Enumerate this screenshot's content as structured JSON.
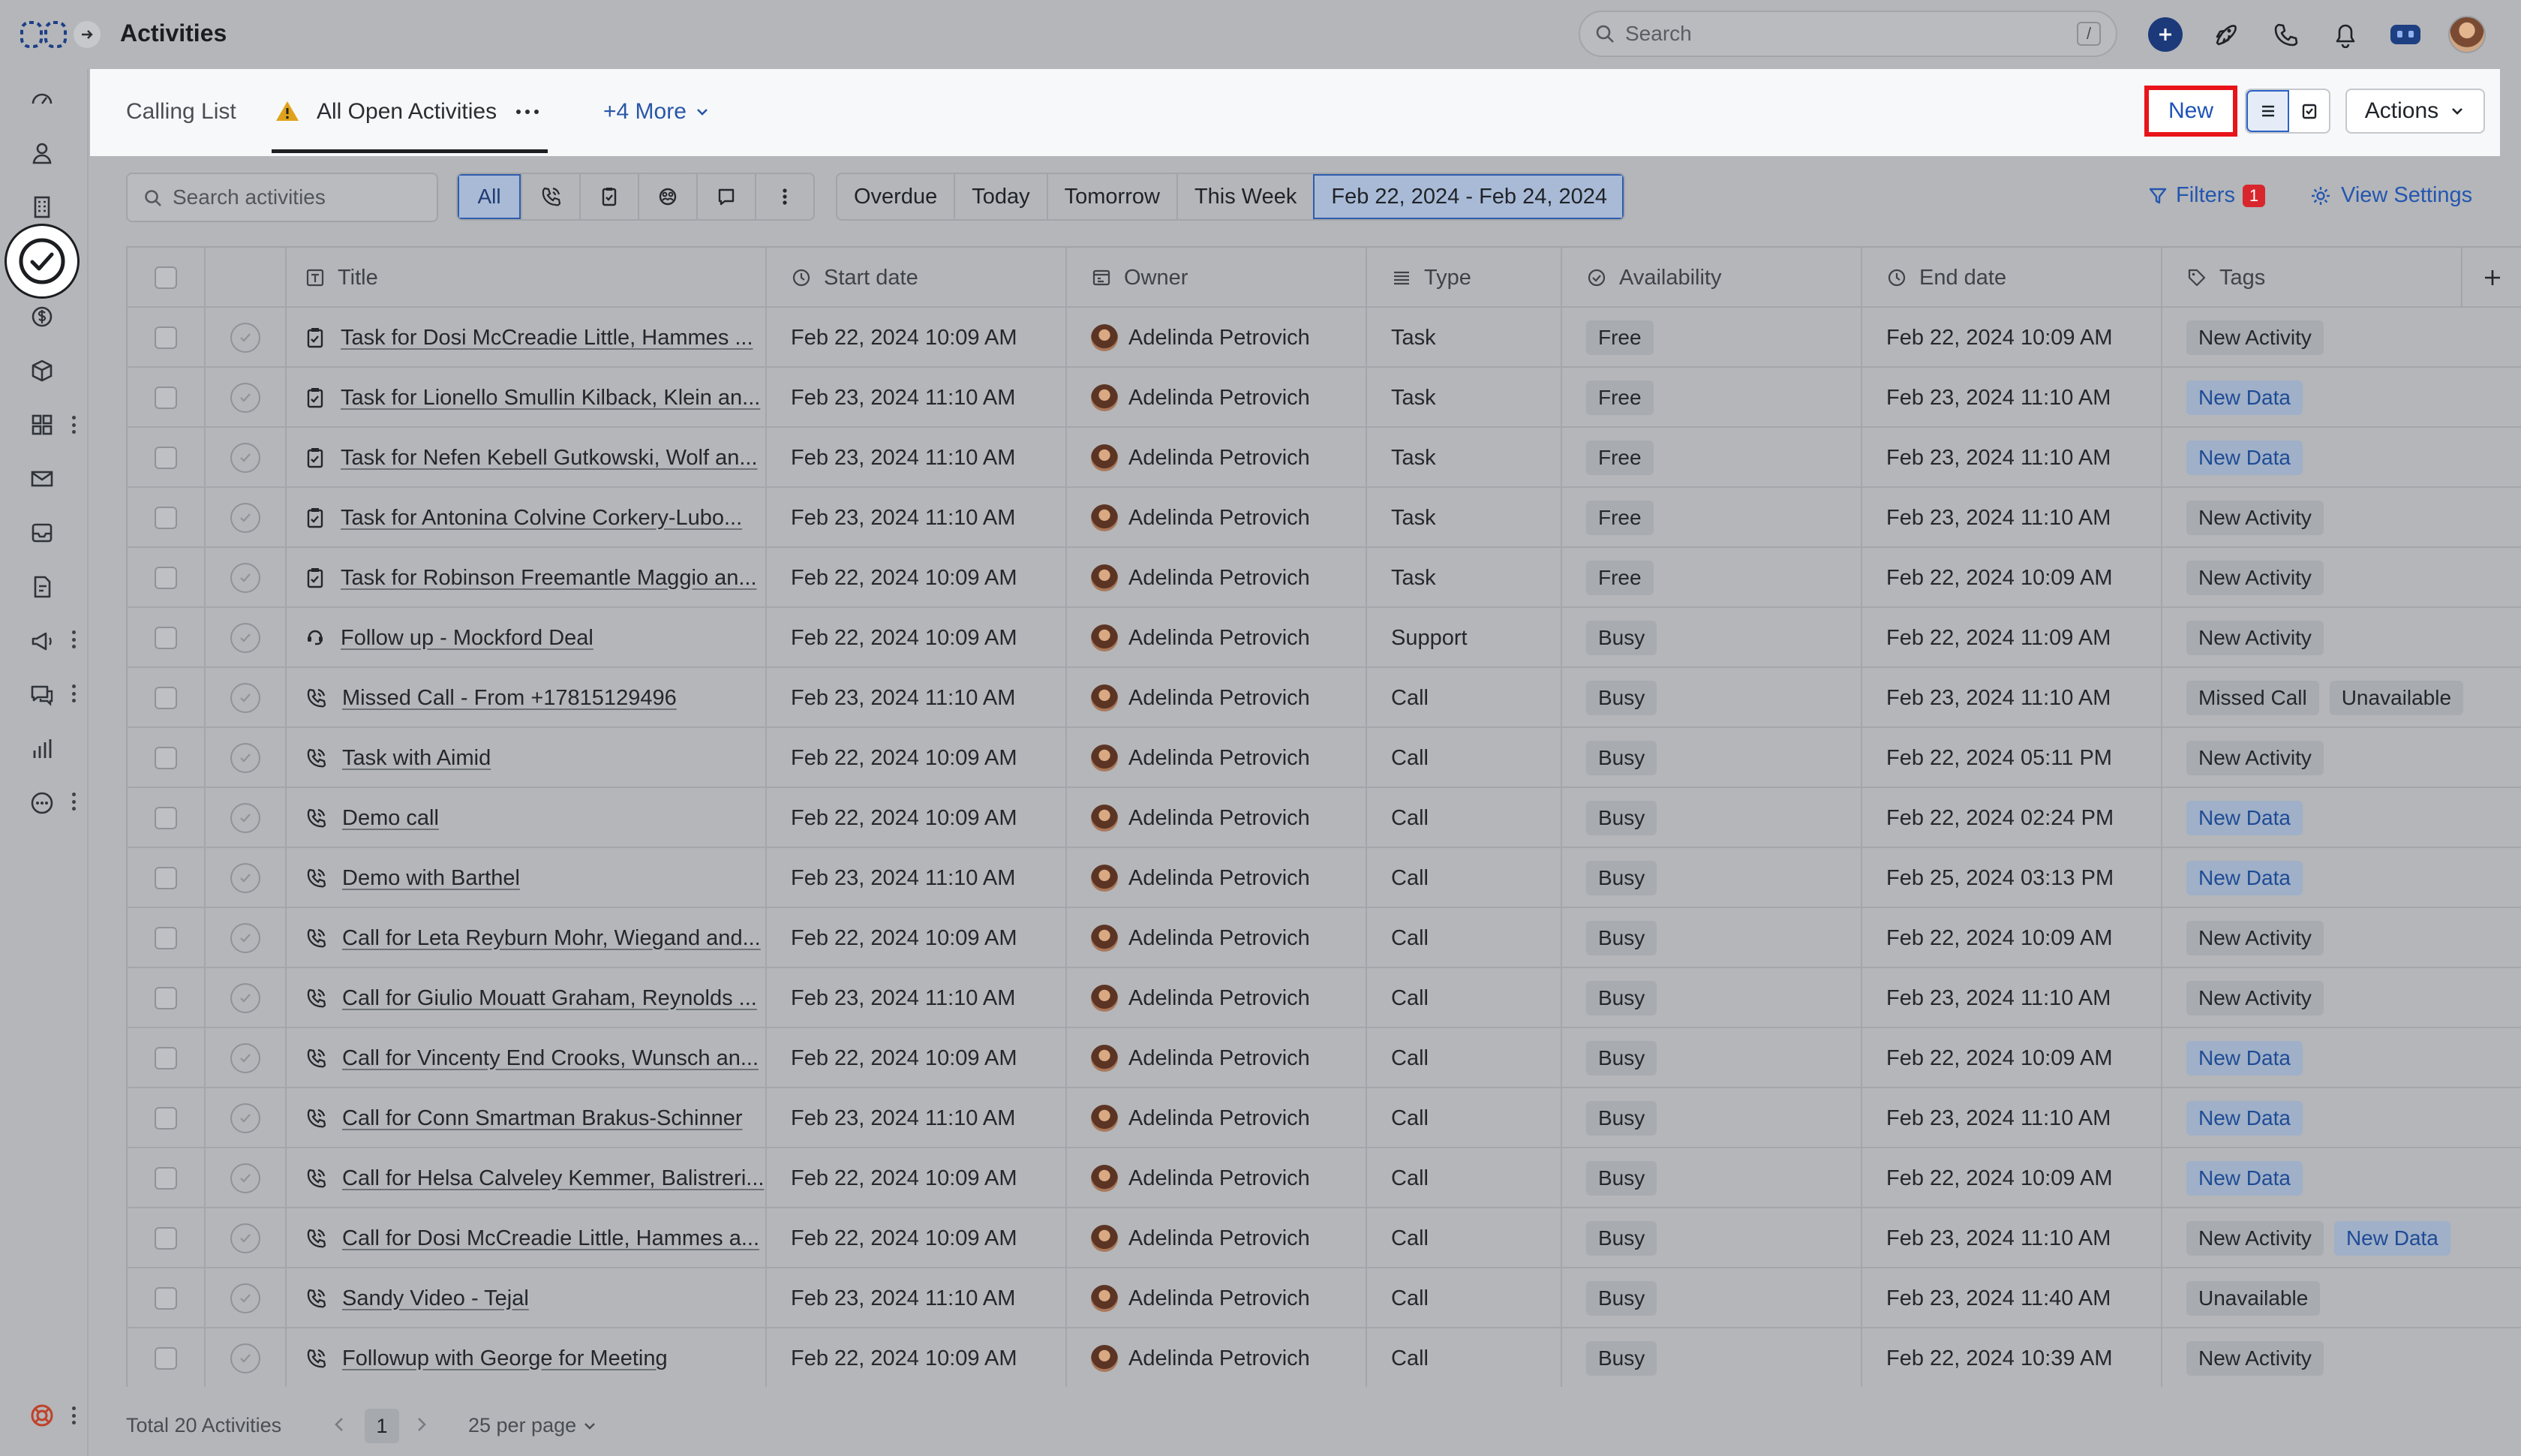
{
  "app": {
    "title": "Activities",
    "search_placeholder": "Search",
    "search_shortcut": "/"
  },
  "tabs": {
    "items": [
      {
        "label": "Calling List"
      },
      {
        "label": "All Open Activities",
        "warning": true
      }
    ],
    "more_label": "+4 More",
    "new_label": "New",
    "actions_label": "Actions"
  },
  "filterbar": {
    "search_placeholder": "Search activities",
    "type_all": "All",
    "type_icons": [
      "phone-icon",
      "task-icon",
      "meeting-icon",
      "chat-icon",
      "more-vertical-icon"
    ],
    "dates": [
      "Overdue",
      "Today",
      "Tomorrow",
      "This Week",
      "Feb 22, 2024 - Feb 24, 2024"
    ],
    "selected_date": "Feb 22, 2024 - Feb 24, 2024",
    "filters_label": "Filters",
    "filters_count": "1",
    "view_settings_label": "View Settings"
  },
  "table": {
    "columns": [
      "Title",
      "Start date",
      "Owner",
      "Type",
      "Availability",
      "End date",
      "Tags"
    ],
    "rows": [
      {
        "icon": "task",
        "title": "Task for Dosi McCreadie Little, Hammes ...",
        "start": "Feb 22, 2024 10:09 AM",
        "owner": "Adelinda Petrovich",
        "type": "Task",
        "availability": "Free",
        "end": "Feb 22, 2024 10:09 AM",
        "tags": [
          {
            "label": "New Activity",
            "style": "gray"
          }
        ]
      },
      {
        "icon": "task",
        "title": "Task for Lionello Smullin Kilback, Klein an...",
        "start": "Feb 23, 2024 11:10 AM",
        "owner": "Adelinda Petrovich",
        "type": "Task",
        "availability": "Free",
        "end": "Feb 23, 2024 11:10 AM",
        "tags": [
          {
            "label": "New Data",
            "style": "blue"
          }
        ]
      },
      {
        "icon": "task",
        "title": "Task for Nefen Kebell Gutkowski, Wolf an...",
        "start": "Feb 23, 2024 11:10 AM",
        "owner": "Adelinda Petrovich",
        "type": "Task",
        "availability": "Free",
        "end": "Feb 23, 2024 11:10 AM",
        "tags": [
          {
            "label": "New Data",
            "style": "blue"
          }
        ]
      },
      {
        "icon": "task",
        "title": "Task for Antonina Colvine Corkery-Lubo...",
        "start": "Feb 23, 2024 11:10 AM",
        "owner": "Adelinda Petrovich",
        "type": "Task",
        "availability": "Free",
        "end": "Feb 23, 2024 11:10 AM",
        "tags": [
          {
            "label": "New Activity",
            "style": "gray"
          }
        ]
      },
      {
        "icon": "task",
        "title": "Task for Robinson Freemantle Maggio an...",
        "start": "Feb 22, 2024 10:09 AM",
        "owner": "Adelinda Petrovich",
        "type": "Task",
        "availability": "Free",
        "end": "Feb 22, 2024 10:09 AM",
        "tags": [
          {
            "label": "New Activity",
            "style": "gray"
          }
        ]
      },
      {
        "icon": "support",
        "title": "Follow up - Mockford Deal",
        "start": "Feb 22, 2024 10:09 AM",
        "owner": "Adelinda Petrovich",
        "type": "Support",
        "availability": "Busy",
        "end": "Feb 22, 2024 11:09 AM",
        "tags": [
          {
            "label": "New Activity",
            "style": "gray"
          }
        ]
      },
      {
        "icon": "call",
        "title": "Missed Call - From +17815129496",
        "start": "Feb 23, 2024 11:10 AM",
        "owner": "Adelinda Petrovich",
        "type": "Call",
        "availability": "Busy",
        "end": "Feb 23, 2024 11:10 AM",
        "tags": [
          {
            "label": "Missed Call",
            "style": "gray"
          },
          {
            "label": "Unavailable",
            "style": "gray"
          }
        ]
      },
      {
        "icon": "call",
        "title": "Task with Aimid",
        "start": "Feb 22, 2024 10:09 AM",
        "owner": "Adelinda Petrovich",
        "type": "Call",
        "availability": "Busy",
        "end": "Feb 22, 2024 05:11 PM",
        "tags": [
          {
            "label": "New Activity",
            "style": "gray"
          }
        ]
      },
      {
        "icon": "call",
        "title": "Demo call",
        "start": "Feb 22, 2024 10:09 AM",
        "owner": "Adelinda Petrovich",
        "type": "Call",
        "availability": "Busy",
        "end": "Feb 22, 2024 02:24 PM",
        "tags": [
          {
            "label": "New Data",
            "style": "blue"
          }
        ]
      },
      {
        "icon": "call",
        "title": "Demo with Barthel",
        "start": "Feb 23, 2024 11:10 AM",
        "owner": "Adelinda Petrovich",
        "type": "Call",
        "availability": "Busy",
        "end": "Feb 25, 2024 03:13 PM",
        "tags": [
          {
            "label": "New Data",
            "style": "blue"
          }
        ]
      },
      {
        "icon": "call",
        "title": "Call for Leta Reyburn Mohr, Wiegand and...",
        "start": "Feb 22, 2024 10:09 AM",
        "owner": "Adelinda Petrovich",
        "type": "Call",
        "availability": "Busy",
        "end": "Feb 22, 2024 10:09 AM",
        "tags": [
          {
            "label": "New Activity",
            "style": "gray"
          }
        ]
      },
      {
        "icon": "call",
        "title": "Call for Giulio Mouatt Graham, Reynolds ...",
        "start": "Feb 23, 2024 11:10 AM",
        "owner": "Adelinda Petrovich",
        "type": "Call",
        "availability": "Busy",
        "end": "Feb 23, 2024 11:10 AM",
        "tags": [
          {
            "label": "New Activity",
            "style": "gray"
          }
        ]
      },
      {
        "icon": "call",
        "title": "Call for Vincenty End Crooks, Wunsch an...",
        "start": "Feb 22, 2024 10:09 AM",
        "owner": "Adelinda Petrovich",
        "type": "Call",
        "availability": "Busy",
        "end": "Feb 22, 2024 10:09 AM",
        "tags": [
          {
            "label": "New Data",
            "style": "blue"
          }
        ]
      },
      {
        "icon": "call",
        "title": "Call for Conn Smartman Brakus-Schinner",
        "start": "Feb 23, 2024 11:10 AM",
        "owner": "Adelinda Petrovich",
        "type": "Call",
        "availability": "Busy",
        "end": "Feb 23, 2024 11:10 AM",
        "tags": [
          {
            "label": "New Data",
            "style": "blue"
          }
        ]
      },
      {
        "icon": "call",
        "title": "Call for Helsa Calveley Kemmer, Balistreri...",
        "start": "Feb 22, 2024 10:09 AM",
        "owner": "Adelinda Petrovich",
        "type": "Call",
        "availability": "Busy",
        "end": "Feb 22, 2024 10:09 AM",
        "tags": [
          {
            "label": "New Data",
            "style": "blue"
          }
        ]
      },
      {
        "icon": "call",
        "title": "Call for Dosi McCreadie Little, Hammes a...",
        "start": "Feb 22, 2024 10:09 AM",
        "owner": "Adelinda Petrovich",
        "type": "Call",
        "availability": "Busy",
        "end": "Feb 23, 2024 11:10 AM",
        "tags": [
          {
            "label": "New Activity",
            "style": "gray"
          },
          {
            "label": "New Data",
            "style": "blue"
          }
        ]
      },
      {
        "icon": "call",
        "title": "Sandy Video - Tejal",
        "start": "Feb 23, 2024 11:10 AM",
        "owner": "Adelinda Petrovich",
        "type": "Call",
        "availability": "Busy",
        "end": "Feb 23, 2024 11:40 AM",
        "tags": [
          {
            "label": "Unavailable",
            "style": "gray"
          }
        ]
      },
      {
        "icon": "call",
        "title": "Followup with George for Meeting",
        "start": "Feb 22, 2024 10:09 AM",
        "owner": "Adelinda Petrovich",
        "type": "Call",
        "availability": "Busy",
        "end": "Feb 22, 2024 10:39 AM",
        "tags": [
          {
            "label": "New Activity",
            "style": "gray"
          }
        ]
      }
    ]
  },
  "footer": {
    "total": "Total 20 Activities",
    "page": "1",
    "per_page": "25 per page"
  },
  "sidebar_icons": [
    "dashboard-icon",
    "contacts-icon",
    "accounts-icon",
    "activities-icon",
    "deals-icon",
    "products-icon",
    "apps-icon",
    "mail-icon",
    "inbox-icon",
    "documents-icon",
    "campaigns-icon",
    "chat-icon",
    "reports-icon",
    "more-icon"
  ],
  "colors": {
    "accent": "#2456b0",
    "highlight_border": "#e8141a",
    "danger_badge": "#d8262c"
  }
}
